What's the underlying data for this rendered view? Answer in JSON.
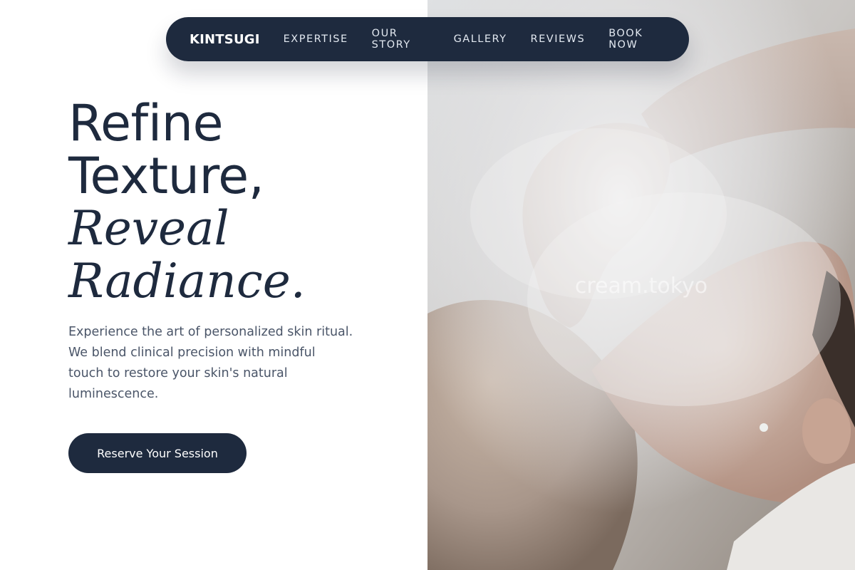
{
  "nav": {
    "brand": "KINTSUGI",
    "links": [
      "EXPERTISE",
      "OUR STORY",
      "GALLERY",
      "REVIEWS",
      "BOOK NOW"
    ]
  },
  "hero": {
    "headline_line1": "Refine",
    "headline_line2": "Texture,",
    "headline_line3": "Reveal",
    "headline_line4": "Radiance.",
    "description": "Experience the art of personalized skin ritual. We blend clinical precision with mindful touch to restore your skin's natural luminescence.",
    "cta_label": "Reserve Your Session",
    "image_watermark": "cream.tokyo"
  },
  "colors": {
    "primary": "#1e2a3e",
    "text_muted": "#4a5568",
    "background": "#ffffff"
  }
}
